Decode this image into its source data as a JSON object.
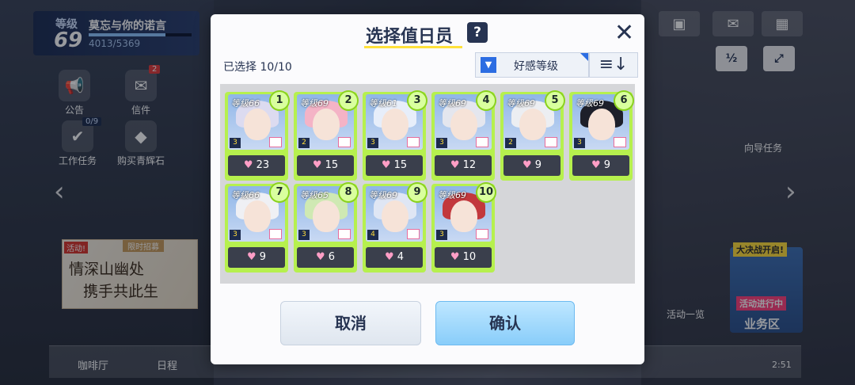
{
  "player": {
    "level_label": "等级",
    "level": "69",
    "name": "莫忘与你的诺言",
    "exp": "4013/5369",
    "exp_fraction": 0.747
  },
  "side_menu": {
    "announce": "公告",
    "letters": "信件",
    "letters_badge": "2",
    "tasks": "工作任务",
    "tasks_badge": "0/9",
    "shop": "购买青辉石"
  },
  "banner": {
    "tag": "活动!",
    "tag2": "限时招募",
    "line1": "情深山幽处",
    "line2": "携手共此生"
  },
  "right_panel": {
    "guide": "向导任务",
    "activity": "活动一览",
    "event_tag": "大决战开启!",
    "event_status": "活动进行中",
    "event_label": "业务区"
  },
  "bottom_bar": {
    "cafe": "咖啡厅",
    "schedule": "日程"
  },
  "clock": "2:51",
  "modal": {
    "title": "选择值日员",
    "help": "?",
    "close": "✕",
    "selected": "已选择 10/10",
    "filter_label": "好感等级",
    "sort_icon": "≡↓",
    "cancel": "取消",
    "confirm": "确认"
  },
  "characters": [
    {
      "level": "等级66",
      "order": "1",
      "bond": "23",
      "rank": "3",
      "hair": "#dcdbf0"
    },
    {
      "level": "等级69",
      "order": "2",
      "bond": "15",
      "rank": "2",
      "hair": "#f4b3c6"
    },
    {
      "level": "等级61",
      "order": "3",
      "bond": "15",
      "rank": "3",
      "hair": "#e7eefa"
    },
    {
      "level": "等级69",
      "order": "4",
      "bond": "12",
      "rank": "3",
      "hair": "#e4e6ee"
    },
    {
      "level": "等级69",
      "order": "5",
      "bond": "9",
      "rank": "2",
      "hair": "#eceef2"
    },
    {
      "level": "等级69",
      "order": "6",
      "bond": "9",
      "rank": "3",
      "hair": "#1d1f2a"
    },
    {
      "level": "等级66",
      "order": "7",
      "bond": "9",
      "rank": "3",
      "hair": "#eff0f4"
    },
    {
      "level": "等级65",
      "order": "8",
      "bond": "6",
      "rank": "3",
      "hair": "#cfe9b3"
    },
    {
      "level": "等级69",
      "order": "9",
      "bond": "4",
      "rank": "4",
      "hair": "#dfe6f4"
    },
    {
      "level": "等级69",
      "order": "10",
      "bond": "10",
      "rank": "3",
      "hair": "#c2383d"
    }
  ],
  "icons": [
    "megaphone-icon",
    "letter-icon",
    "task-icon",
    "shop-icon",
    "coffee-icon",
    "calendar-icon",
    "mail-icon",
    "grid-icon",
    "expand-icon",
    "filter-icon",
    "sort-icon",
    "heart-icon",
    "help-icon",
    "close-icon"
  ]
}
